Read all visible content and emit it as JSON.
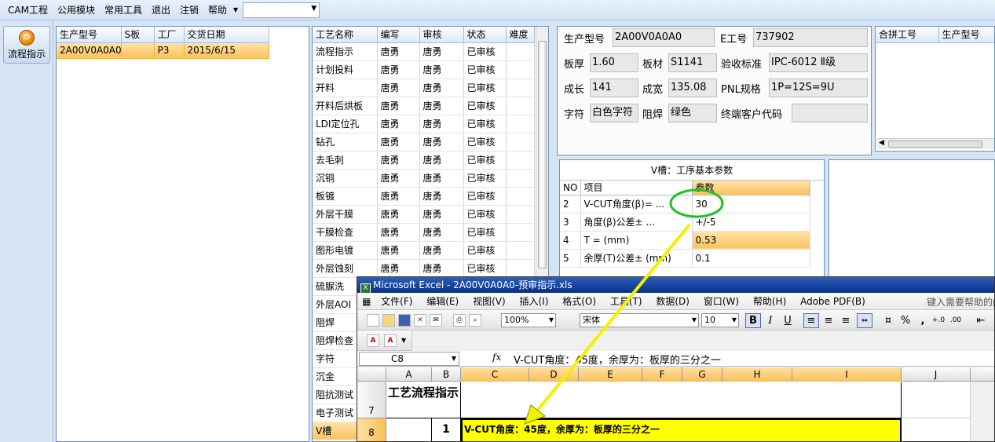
{
  "menubar": {
    "items": [
      "CAM工程",
      "公用模块",
      "常用工具",
      "退出",
      "注销",
      "帮助"
    ]
  },
  "leftnav": {
    "button_label": "流程指示"
  },
  "orders": {
    "columns": [
      "生产型号",
      "S板",
      "工厂",
      "交货日期"
    ],
    "rows": [
      [
        "2A00V0A0A0",
        "",
        "P3",
        "2015/6/15"
      ]
    ]
  },
  "process": {
    "columns": [
      "工艺名称",
      "编写",
      "审核",
      "状态",
      "难度"
    ],
    "rows": [
      [
        "流程指示",
        "唐勇",
        "唐勇",
        "已审核",
        ""
      ],
      [
        "计划投料",
        "唐勇",
        "唐勇",
        "已审核",
        ""
      ],
      [
        "开料",
        "唐勇",
        "唐勇",
        "已审核",
        ""
      ],
      [
        "开料后烘板",
        "唐勇",
        "唐勇",
        "已审核",
        ""
      ],
      [
        "LDI定位孔",
        "唐勇",
        "唐勇",
        "已审核",
        ""
      ],
      [
        "钻孔",
        "唐勇",
        "唐勇",
        "已审核",
        ""
      ],
      [
        "去毛刺",
        "唐勇",
        "唐勇",
        "已审核",
        ""
      ],
      [
        "沉铜",
        "唐勇",
        "唐勇",
        "已审核",
        ""
      ],
      [
        "板镀",
        "唐勇",
        "唐勇",
        "已审核",
        ""
      ],
      [
        "外层干膜",
        "唐勇",
        "唐勇",
        "已审核",
        ""
      ],
      [
        "干膜检查",
        "唐勇",
        "唐勇",
        "已审核",
        ""
      ],
      [
        "图形电镀",
        "唐勇",
        "唐勇",
        "已审核",
        ""
      ],
      [
        "外层蚀刻",
        "唐勇",
        "唐勇",
        "已审核",
        ""
      ],
      [
        "硫脲洗",
        "",
        "",
        "",
        ""
      ],
      [
        "外层AOI",
        "",
        "",
        "",
        ""
      ],
      [
        "阻焊",
        "",
        "",
        "",
        ""
      ],
      [
        "阻焊检查",
        "",
        "",
        "",
        ""
      ],
      [
        "字符",
        "",
        "",
        "",
        ""
      ],
      [
        "沉金",
        "",
        "",
        "",
        ""
      ],
      [
        "阻抗测试",
        "",
        "",
        "",
        ""
      ],
      [
        "电子测试",
        "",
        "",
        "",
        ""
      ],
      [
        "V槽",
        "",
        "",
        "",
        ""
      ]
    ]
  },
  "info": {
    "model_label": "生产型号",
    "model_value": "2A00V0A0A0",
    "eno_label": "E工号",
    "eno_value": "737902",
    "thick_label": "板厚",
    "thick_value": "1.60",
    "mat_label": "板材",
    "mat_value": "S1141",
    "std_label": "验收标准",
    "std_value": "IPC-6012 Ⅱ级",
    "len_label": "成长",
    "len_value": "141",
    "wid_label": "成宽",
    "wid_value": "135.08",
    "pnl_label": "PNL规格",
    "pnl_value": "1P=12S=9U",
    "char_label": "字符",
    "char_value": "白色字符",
    "mask_label": "阻焊",
    "mask_value": "绿色",
    "cust_label": "终端客户代码",
    "cust_value": ""
  },
  "merge": {
    "columns": [
      "合拼工号",
      "生产型号"
    ]
  },
  "vcut": {
    "title": "V槽：工序基本参数",
    "columns": [
      "NO",
      "项目",
      "参数"
    ],
    "rows": [
      [
        "2",
        "V-CUT角度(β)=  ...",
        "30"
      ],
      [
        "3",
        "角度(β)公差±  ...",
        "+/-5"
      ],
      [
        "4",
        "T =  (mm)",
        "0.53"
      ],
      [
        "5",
        "余厚(T)公差±  (mm)",
        "0.1"
      ]
    ]
  },
  "excel": {
    "title": "Microsoft Excel - 2A00V0A0A0-预审指示.xls",
    "menu": [
      "文件(F)",
      "编辑(E)",
      "视图(V)",
      "插入(I)",
      "格式(O)",
      "工具(T)",
      "数据(D)",
      "窗口(W)",
      "帮助(H)",
      "Adobe PDF(B)"
    ],
    "help_text": "键入需要帮助的问",
    "zoom": "100%",
    "font_name": "宋体",
    "font_size": "10",
    "name_box": "C8",
    "fx": "fx",
    "formula": "V-CUT角度：45度，余厚为：板厚的三分之一",
    "col_headers": [
      "A",
      "B",
      "C",
      "D",
      "E",
      "F",
      "G",
      "H",
      "I",
      "J"
    ],
    "row7_label": "7",
    "row8_label": "8",
    "a7_text": "工艺流程指示",
    "b8_text": "1",
    "c8_text": "V-CUT角度：45度，余厚为：板厚的三分之一",
    "highlight_color": "#ffff00"
  },
  "annotation": {
    "circle_color": "#1ec41e",
    "arrow_color": "#f2f200"
  }
}
